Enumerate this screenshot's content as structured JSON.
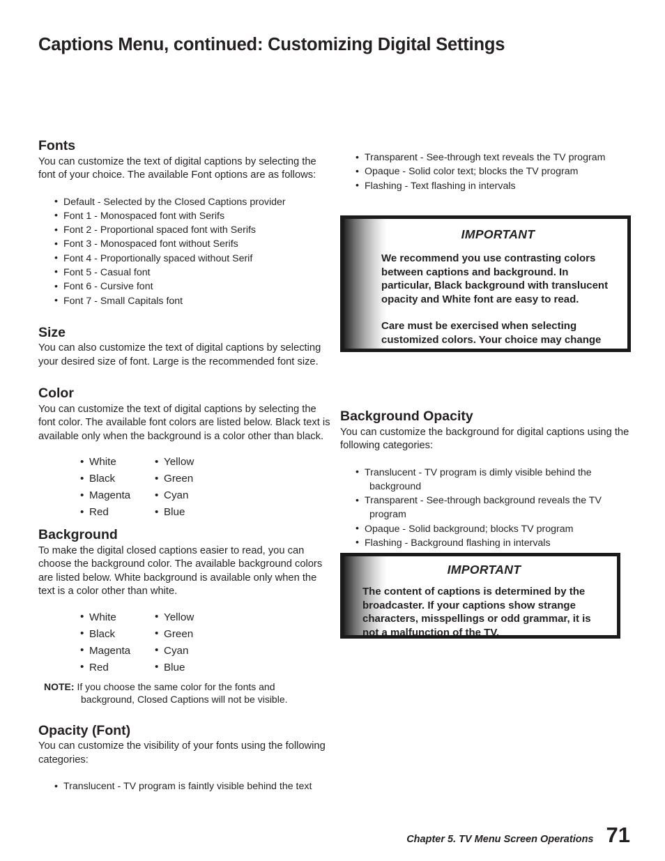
{
  "page": {
    "title": "Captions Menu, continued: Customizing Digital Settings",
    "background_color": "#ffffff",
    "text_color": "#231f20"
  },
  "left_column": {
    "fonts": {
      "heading": "Fonts",
      "body": "You can customize the text of digital captions by selecting the font of your choice.  The available Font options are as follows:",
      "items": [
        "Default - Selected by the Closed Captions provider",
        "Font 1 - Monospaced font with Serifs",
        "Font 2 - Proportional spaced font with Serifs",
        "Font 3 - Monospaced font without Serifs",
        "Font 4 - Proportionally spaced without Serif",
        "Font 5 - Casual font",
        "Font 6 - Cursive font",
        "Font 7 - Small Capitals font"
      ]
    },
    "size": {
      "heading": "Size",
      "body": "You can also customize the text of digital captions by selecting your desired size of font.  Large is the recommended font size."
    },
    "color": {
      "heading": "Color",
      "body": "You can customize the text of digital captions by selecting the font color.  The available font colors are listed below.  Black text is available only when the background is a color other than black.",
      "colors_col1": [
        "White",
        "Black",
        "Magenta",
        "Red"
      ],
      "colors_col2": [
        "Yellow",
        "Green",
        "Cyan",
        "Blue"
      ]
    },
    "background": {
      "heading": "Background",
      "body": "To make the digital closed captions easier to read, you can choose the background color.  The available background colors are listed below.  White background is available only when the text is a color other than white.",
      "colors_col1": [
        "White",
        "Black",
        "Magenta",
        "Red"
      ],
      "colors_col2": [
        "Yellow",
        "Green",
        "Cyan",
        "Blue"
      ],
      "note_label": "NOTE:",
      "note_text": "If you choose the same color for the fonts and background, Closed Captions will not be visible."
    },
    "opacity_font": {
      "heading": "Opacity (Font)",
      "body": "You can customize the visibility of your fonts using the following categories:",
      "items": [
        "Translucent - TV program is faintly visible behind the text"
      ]
    }
  },
  "right_column": {
    "opacity_font_continued": {
      "items": [
        "Transparent - See-through text reveals the TV program",
        "Opaque - Solid color text; blocks the TV program",
        "Flashing - Text flashing in intervals"
      ]
    },
    "important_box_1": {
      "title": "IMPORTANT",
      "paragraph_1": "We recommend you use contrasting colors between captions and background.  In particular, Black background with translucent opacity and White font are easy to read.",
      "paragraph_2": "Care must be exercised when selecting customized colors.  Your choice may change the legibility or readability of captions."
    },
    "background_opacity": {
      "heading": "Background Opacity",
      "body": "You can customize the background for digital captions using the following categories:",
      "items": [
        {
          "main": "Translucent - TV program is dimly visible behind the",
          "cont": "background"
        },
        {
          "main": "Transparent - See-through background reveals the TV",
          "cont": "program"
        },
        {
          "main": "Opaque - Solid background; blocks TV program",
          "cont": ""
        },
        {
          "main": "Flashing - Background flashing in intervals",
          "cont": ""
        }
      ]
    },
    "important_box_2": {
      "title": "IMPORTANT",
      "paragraph_1": "The content of captions is determined by the broadcaster.  If your captions show strange characters, misspellings or odd grammar, it is not a malfunction of the TV."
    }
  },
  "footer": {
    "chapter": "Chapter 5. TV Menu Screen Operations",
    "page_number": "71"
  }
}
